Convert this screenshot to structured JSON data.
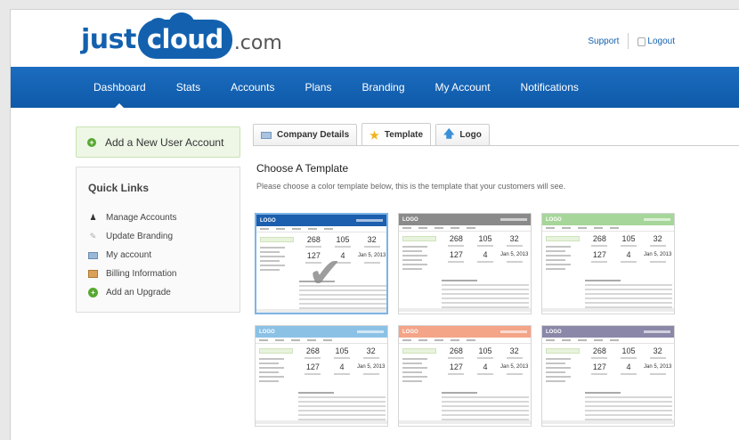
{
  "brand": {
    "just": "just",
    "cloud": "cloud",
    "com": ".com"
  },
  "top_links": {
    "support": "Support",
    "logout": "Logout"
  },
  "nav": [
    "Dashboard",
    "Stats",
    "Accounts",
    "Plans",
    "Branding",
    "My Account",
    "Notifications"
  ],
  "nav_active": "Dashboard",
  "left": {
    "add_user": "Add a New User Account",
    "quick_links_title": "Quick Links",
    "quick_links": [
      "Manage Accounts",
      "Update Branding",
      "My account",
      "Billing Information",
      "Add an Upgrade"
    ]
  },
  "tabs": [
    "Company Details",
    "Template",
    "Logo"
  ],
  "active_tab": "Template",
  "main": {
    "title": "Choose A Template",
    "description": "Please choose a color template below, this is the template that your customers will see."
  },
  "templates": [
    {
      "color": "#1c5fae",
      "logo": "LOGO",
      "selected": true
    },
    {
      "color": "#8a8a8a",
      "logo": "LOGO",
      "selected": false
    },
    {
      "color": "#a6d69a",
      "logo": "LOGO",
      "selected": false
    },
    {
      "color": "#8cc1e6",
      "logo": "LOGO",
      "selected": false
    },
    {
      "color": "#f4a487",
      "logo": "LOGO",
      "selected": false
    },
    {
      "color": "#8a87a8",
      "logo": "LOGO",
      "selected": false
    }
  ],
  "template_stats": [
    "268",
    "105",
    "32",
    "127",
    "4",
    "Jan 5, 2013"
  ],
  "colors": {
    "brand_blue": "#1361ae",
    "nav_blue": "#1466b8",
    "green": "#56a832"
  }
}
